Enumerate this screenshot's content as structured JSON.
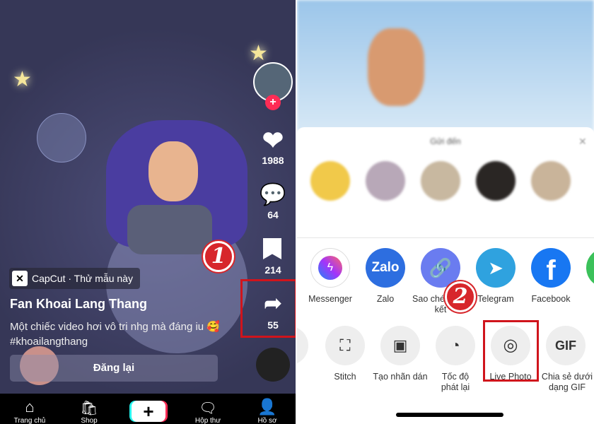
{
  "left": {
    "capcut_label": "CapCut · Thử mẫu này",
    "author": "Fan Khoai Lang Thang",
    "caption": "Một chiếc video hơi vô tri nhg mà đáng iu 🥰 #khoailangthang",
    "repost_button": "Đăng lại",
    "likes": "1988",
    "comments": "64",
    "saves": "214",
    "shares": "55",
    "step_badge": "1",
    "nav": [
      {
        "label": "Trang chủ",
        "icon": "home-icon"
      },
      {
        "label": "Shop",
        "icon": "shop-icon"
      },
      {
        "label": "+",
        "icon": "create-icon"
      },
      {
        "label": "Hộp thư",
        "icon": "inbox-icon"
      },
      {
        "label": "Hồ sơ",
        "icon": "profile-icon"
      }
    ]
  },
  "right": {
    "sheet_title": "Gửi đến",
    "share_apps": [
      {
        "label": "Messenger",
        "color": "#ffffff"
      },
      {
        "label": "Zalo",
        "color": "#2d6ee0"
      },
      {
        "label": "Sao chép Liên kết",
        "color": "#6a7cf0"
      },
      {
        "label": "Telegram",
        "color": "#2fa2df"
      },
      {
        "label": "Facebook",
        "color": "#1877f2"
      }
    ],
    "zalo_logo": "Zalo",
    "actions": [
      {
        "label": "Stitch"
      },
      {
        "label": "Tạo nhãn dán"
      },
      {
        "label": "Tốc độ phát lại"
      },
      {
        "label": "Live Photo"
      },
      {
        "label": "Chia sẻ dưới dạng GIF"
      }
    ],
    "gif_text": "GIF",
    "step_badge": "2",
    "accent": "#d0141c"
  }
}
